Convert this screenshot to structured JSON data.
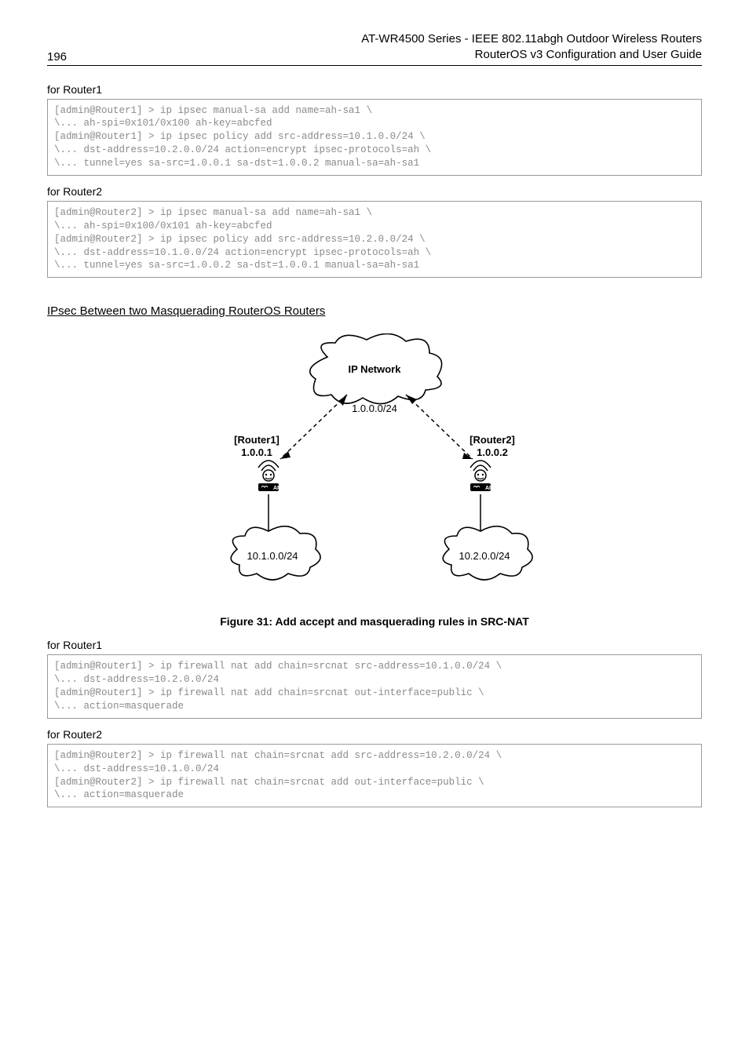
{
  "header": {
    "page_number": "196",
    "title_line1": "AT-WR4500 Series - IEEE 802.11abgh Outdoor Wireless Routers",
    "title_line2": "RouterOS v3 Configuration and User Guide"
  },
  "block1": {
    "label": "for Router1",
    "code": "[admin@Router1] > ip ipsec manual-sa add name=ah-sa1 \\\n\\... ah-spi=0x101/0x100 ah-key=abcfed\n[admin@Router1] > ip ipsec policy add src-address=10.1.0.0/24 \\\n\\... dst-address=10.2.0.0/24 action=encrypt ipsec-protocols=ah \\\n\\... tunnel=yes sa-src=1.0.0.1 sa-dst=1.0.0.2 manual-sa=ah-sa1"
  },
  "block2": {
    "label": "for Router2",
    "code": "[admin@Router2] > ip ipsec manual-sa add name=ah-sa1 \\\n\\... ah-spi=0x100/0x101 ah-key=abcfed\n[admin@Router2] > ip ipsec policy add src-address=10.2.0.0/24 \\\n\\... dst-address=10.1.0.0/24 action=encrypt ipsec-protocols=ah \\\n\\... tunnel=yes sa-src=1.0.0.2 sa-dst=1.0.0.1 manual-sa=ah-sa1"
  },
  "section_heading": "IPsec Between two Masquerading RouterOS Routers",
  "diagram": {
    "ip_network": "IP Network",
    "top_subnet": "1.0.0.0/24",
    "router1_label": "[Router1]",
    "router1_ip": "1.0.0.1",
    "router2_label": "[Router2]",
    "router2_ip": "1.0.0.2",
    "left_subnet": "10.1.0.0/24",
    "right_subnet": "10.2.0.0/24"
  },
  "figure_caption": "Figure 31: Add accept and masquerading rules in SRC-NAT",
  "block3": {
    "label": "for Router1",
    "code": "[admin@Router1] > ip firewall nat add chain=srcnat src-address=10.1.0.0/24 \\\n\\... dst-address=10.2.0.0/24\n[admin@Router1] > ip firewall nat add chain=srcnat out-interface=public \\\n\\... action=masquerade"
  },
  "block4": {
    "label": "for Router2",
    "code": "[admin@Router2] > ip firewall nat chain=srcnat add src-address=10.2.0.0/24 \\\n\\... dst-address=10.1.0.0/24\n[admin@Router2] > ip firewall nat chain=srcnat add out-interface=public \\\n\\... action=masquerade"
  }
}
